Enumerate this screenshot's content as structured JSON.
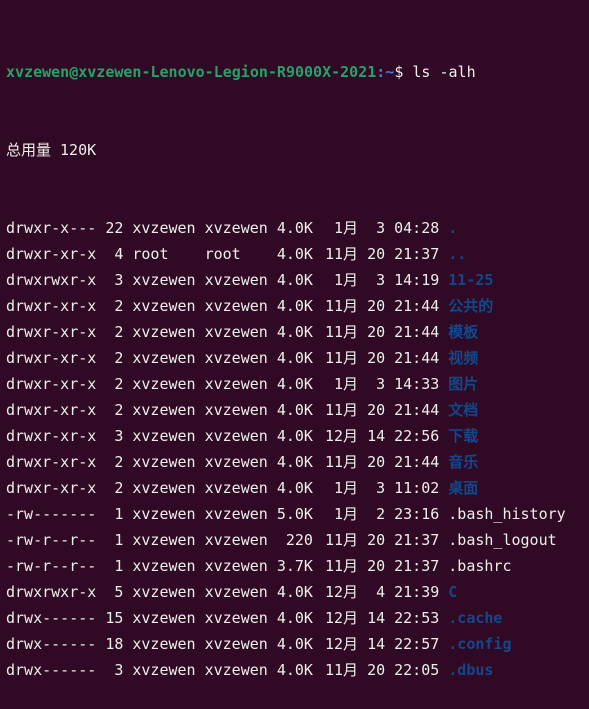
{
  "theme": {
    "background": "#300a24",
    "foreground": "#eeeeec",
    "prompt_color": "#26a269",
    "directory_color": "#12488b"
  },
  "prompt": {
    "user_host": "xvzewen@xvzewen-Lenovo-Legion-R9000X-2021",
    "path": ":~",
    "symbol": "$ ",
    "command": "ls -alh"
  },
  "total": "总用量 120K",
  "entries": [
    {
      "perm": "drwxr-x---",
      "links": "22",
      "owner": "xvzewen",
      "group": "xvzewen",
      "size": "4.0K",
      "month": "1月",
      "day": "3",
      "time": "04:28",
      "name": ".",
      "type": "dir"
    },
    {
      "perm": "drwxr-xr-x",
      "links": "4",
      "owner": "root",
      "group": "root",
      "size": "4.0K",
      "month": "11月",
      "day": "20",
      "time": "21:37",
      "name": "..",
      "type": "dir"
    },
    {
      "perm": "drwxrwxr-x",
      "links": "3",
      "owner": "xvzewen",
      "group": "xvzewen",
      "size": "4.0K",
      "month": "1月",
      "day": "3",
      "time": "14:19",
      "name": "11-25",
      "type": "dir"
    },
    {
      "perm": "drwxr-xr-x",
      "links": "2",
      "owner": "xvzewen",
      "group": "xvzewen",
      "size": "4.0K",
      "month": "11月",
      "day": "20",
      "time": "21:44",
      "name": "公共的",
      "type": "dir"
    },
    {
      "perm": "drwxr-xr-x",
      "links": "2",
      "owner": "xvzewen",
      "group": "xvzewen",
      "size": "4.0K",
      "month": "11月",
      "day": "20",
      "time": "21:44",
      "name": "模板",
      "type": "dir"
    },
    {
      "perm": "drwxr-xr-x",
      "links": "2",
      "owner": "xvzewen",
      "group": "xvzewen",
      "size": "4.0K",
      "month": "11月",
      "day": "20",
      "time": "21:44",
      "name": "视频",
      "type": "dir"
    },
    {
      "perm": "drwxr-xr-x",
      "links": "2",
      "owner": "xvzewen",
      "group": "xvzewen",
      "size": "4.0K",
      "month": "1月",
      "day": "3",
      "time": "14:33",
      "name": "图片",
      "type": "dir"
    },
    {
      "perm": "drwxr-xr-x",
      "links": "2",
      "owner": "xvzewen",
      "group": "xvzewen",
      "size": "4.0K",
      "month": "11月",
      "day": "20",
      "time": "21:44",
      "name": "文档",
      "type": "dir"
    },
    {
      "perm": "drwxr-xr-x",
      "links": "3",
      "owner": "xvzewen",
      "group": "xvzewen",
      "size": "4.0K",
      "month": "12月",
      "day": "14",
      "time": "22:56",
      "name": "下载",
      "type": "dir"
    },
    {
      "perm": "drwxr-xr-x",
      "links": "2",
      "owner": "xvzewen",
      "group": "xvzewen",
      "size": "4.0K",
      "month": "11月",
      "day": "20",
      "time": "21:44",
      "name": "音乐",
      "type": "dir"
    },
    {
      "perm": "drwxr-xr-x",
      "links": "2",
      "owner": "xvzewen",
      "group": "xvzewen",
      "size": "4.0K",
      "month": "1月",
      "day": "3",
      "time": "11:02",
      "name": "桌面",
      "type": "dir"
    },
    {
      "perm": "-rw-------",
      "links": "1",
      "owner": "xvzewen",
      "group": "xvzewen",
      "size": "5.0K",
      "month": "1月",
      "day": "2",
      "time": "23:16",
      "name": ".bash_history",
      "type": "file"
    },
    {
      "perm": "-rw-r--r--",
      "links": "1",
      "owner": "xvzewen",
      "group": "xvzewen",
      "size": "220",
      "month": "11月",
      "day": "20",
      "time": "21:37",
      "name": ".bash_logout",
      "type": "file"
    },
    {
      "perm": "-rw-r--r--",
      "links": "1",
      "owner": "xvzewen",
      "group": "xvzewen",
      "size": "3.7K",
      "month": "11月",
      "day": "20",
      "time": "21:37",
      "name": ".bashrc",
      "type": "file"
    },
    {
      "perm": "drwxrwxr-x",
      "links": "5",
      "owner": "xvzewen",
      "group": "xvzewen",
      "size": "4.0K",
      "month": "12月",
      "day": "4",
      "time": "21:39",
      "name": "C",
      "type": "dir"
    },
    {
      "perm": "drwx------",
      "links": "15",
      "owner": "xvzewen",
      "group": "xvzewen",
      "size": "4.0K",
      "month": "12月",
      "day": "14",
      "time": "22:53",
      "name": ".cache",
      "type": "dir"
    },
    {
      "perm": "drwx------",
      "links": "18",
      "owner": "xvzewen",
      "group": "xvzewen",
      "size": "4.0K",
      "month": "12月",
      "day": "14",
      "time": "22:57",
      "name": ".config",
      "type": "dir"
    },
    {
      "perm": "drwx------",
      "links": "3",
      "owner": "xvzewen",
      "group": "xvzewen",
      "size": "4.0K",
      "month": "11月",
      "day": "20",
      "time": "22:05",
      "name": ".dbus",
      "type": "dir"
    }
  ]
}
